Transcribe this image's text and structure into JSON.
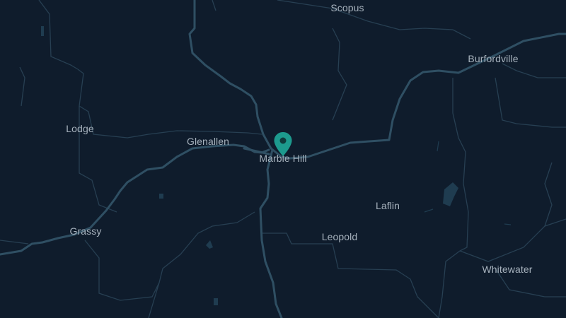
{
  "map": {
    "colors": {
      "background": "#0f1c2c",
      "road": "#2f4f63",
      "boundary": "#273f52",
      "water": "#1f3c50",
      "label": "#a7b2bd",
      "marker": "#1d9a8e"
    },
    "places": {
      "scopus": "Scopus",
      "burfordville": "Burfordville",
      "lodge": "Lodge",
      "glenallen": "Glenallen",
      "marble_hill": "Marble Hill",
      "laflin": "Laflin",
      "grassy": "Grassy",
      "leopold": "Leopold",
      "whitewater": "Whitewater"
    },
    "marker": {
      "icon": "map-pin-icon",
      "place": "Marble Hill"
    }
  }
}
